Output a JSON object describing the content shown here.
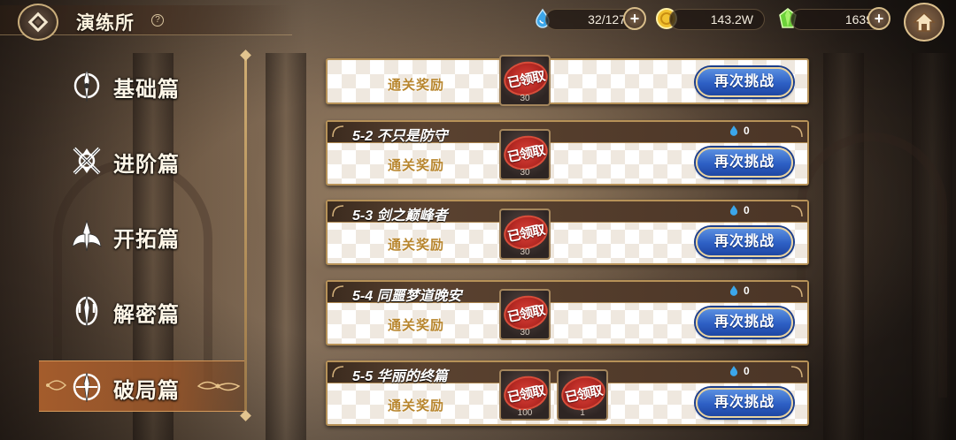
{
  "header": {
    "title": "演练所",
    "help_glyph": "?",
    "resources": [
      {
        "icon": "water-drop-icon",
        "value": "32/127"
      },
      {
        "icon": "gold-coin-icon",
        "value": "143.2W"
      },
      {
        "icon": "green-gem-icon",
        "value": "1639"
      }
    ],
    "plus_glyph": "+"
  },
  "sidebar": {
    "items": [
      {
        "label": "基础篇",
        "icon": "sword-emblem-icon",
        "active": false
      },
      {
        "label": "进阶篇",
        "icon": "crossed-swords-icon",
        "active": false
      },
      {
        "label": "开拓篇",
        "icon": "winged-emblem-icon",
        "active": false
      },
      {
        "label": "解密篇",
        "icon": "trident-emblem-icon",
        "active": false
      },
      {
        "label": "破局篇",
        "icon": "shield-emblem-icon",
        "active": true
      }
    ]
  },
  "stages": [
    {
      "title": "",
      "reward_label": "通关奖励",
      "drop_count": "",
      "claimed": [
        "已领取"
      ],
      "counts": [
        "30"
      ],
      "button": "再次挑战"
    },
    {
      "title": "5-2 不只是防守",
      "reward_label": "通关奖励",
      "drop_count": "0",
      "claimed": [
        "已领取"
      ],
      "counts": [
        "30"
      ],
      "button": "再次挑战"
    },
    {
      "title": "5-3 剑之巅峰者",
      "reward_label": "通关奖励",
      "drop_count": "0",
      "claimed": [
        "已领取"
      ],
      "counts": [
        "30"
      ],
      "button": "再次挑战"
    },
    {
      "title": "5-4 同噩梦道晚安",
      "reward_label": "通关奖励",
      "drop_count": "0",
      "claimed": [
        "已领取"
      ],
      "counts": [
        "30"
      ],
      "button": "再次挑战"
    },
    {
      "title": "5-5 华丽的终篇",
      "reward_label": "通关奖励",
      "drop_count": "0",
      "claimed": [
        "已领取",
        "已领取"
      ],
      "counts": [
        "100",
        "1"
      ],
      "button": "再次挑战"
    }
  ],
  "colors": {
    "accent_gold": "#b79258",
    "button_blue": "#2d5fc4",
    "active_tab": "#aa5f2d",
    "claimed_red": "#d9433a"
  }
}
